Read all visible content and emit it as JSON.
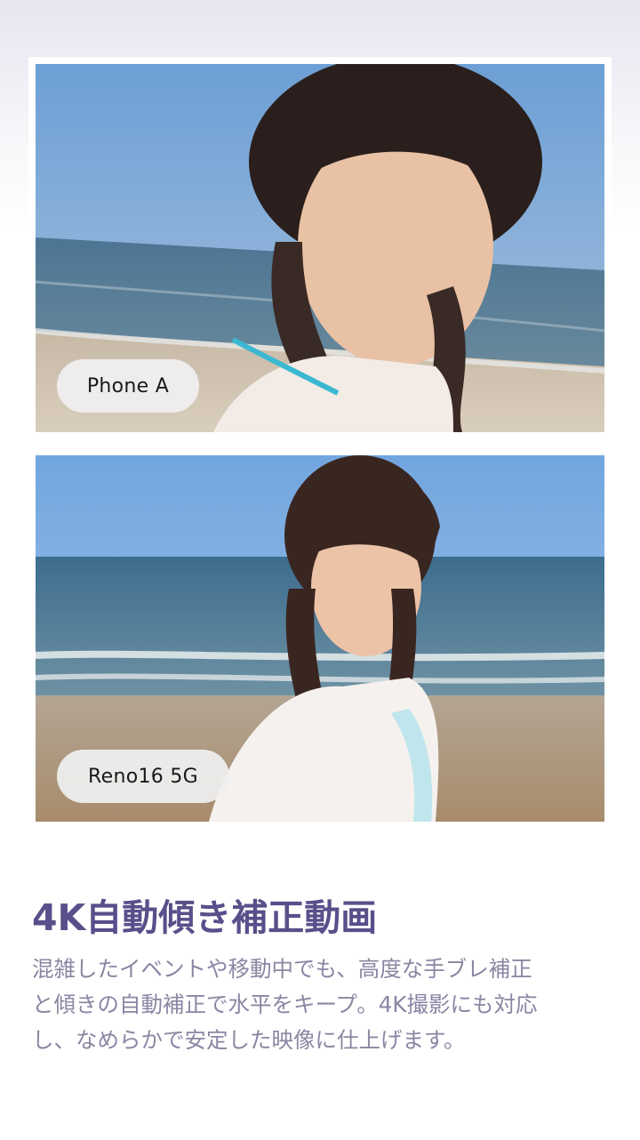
{
  "comparison": {
    "top": {
      "label": "Phone A",
      "image": "beach-portrait-photo"
    },
    "bottom": {
      "label": "Reno16 5G",
      "image": "beach-portrait-photo"
    }
  },
  "feature": {
    "title": "4K自動傾き補正動画",
    "description_lines": [
      "混雑したイベントや移動中でも、高度な手ブレ補正",
      "と傾きの自動補正で水平をキープ。4K撮影にも対応",
      "し、なめらかで安定した映像に仕上げます。"
    ]
  },
  "colors": {
    "title": "#5a4f8a",
    "body": "#8b86a3",
    "pill_bg": "#f0f0f0"
  }
}
